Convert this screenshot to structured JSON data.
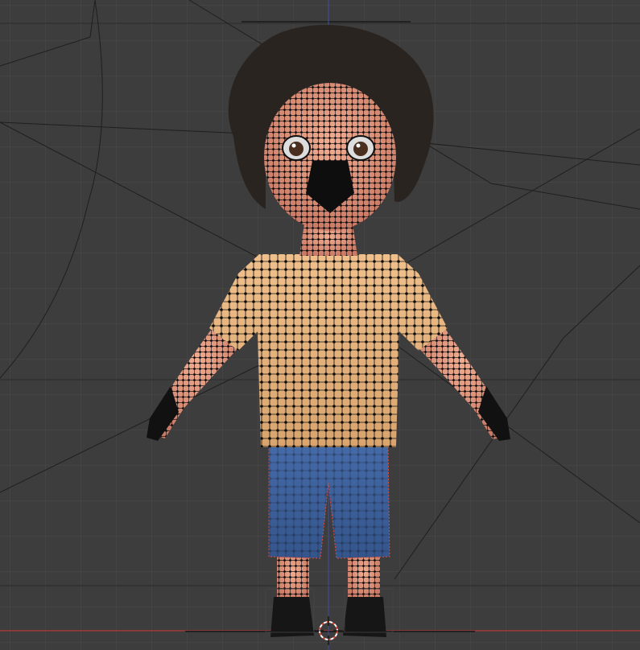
{
  "viewport": {
    "editor": "3d-viewport",
    "view": "front-orthographic",
    "shading": "rendered-with-wireframe-overlay",
    "background_color": "#3d3d3d",
    "grid_color": "#4a4a4a",
    "axis_x_color": "#b23a3a",
    "axis_z_color": "#3a4fa0",
    "colors": {
      "hair": "#2a2420",
      "skin": "#e0957a",
      "shirt": "#e4b47e",
      "shorts": "#3f63a2",
      "shoes": "#1a1a1a",
      "wire": "#111111",
      "selection_outline": "#e04a3a"
    }
  },
  "scene": {
    "object": "character-mesh",
    "cursor": "3d-cursor-icon"
  }
}
